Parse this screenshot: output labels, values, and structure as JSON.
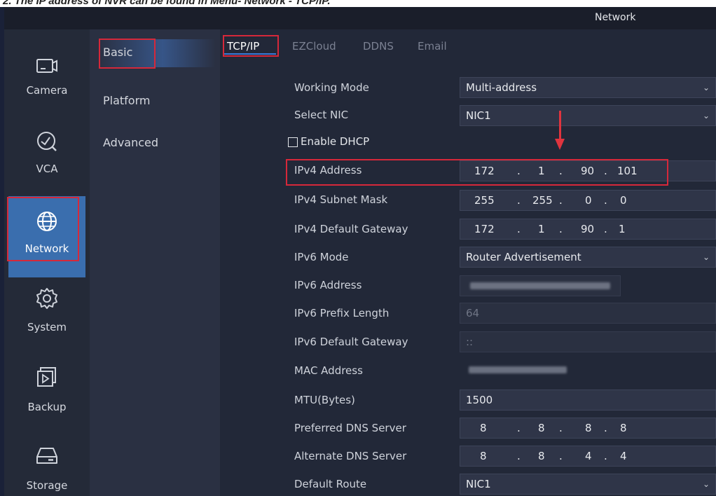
{
  "caption": "2. The IP address of NVR can be found in Menu- Network - TCP/IP.",
  "window": {
    "title": "Network"
  },
  "sidebar": {
    "items": [
      {
        "label": "Camera",
        "icon": "camera-icon"
      },
      {
        "label": "VCA",
        "icon": "vca-icon"
      },
      {
        "label": "Network",
        "icon": "globe-icon",
        "active": true
      },
      {
        "label": "System",
        "icon": "gear-icon"
      },
      {
        "label": "Backup",
        "icon": "backup-icon"
      },
      {
        "label": "Storage",
        "icon": "storage-icon"
      }
    ]
  },
  "submenu": {
    "items": [
      "Basic",
      "Platform",
      "Advanced"
    ],
    "selected": "Basic"
  },
  "tabs": [
    "TCP/IP",
    "EZCloud",
    "DDNS",
    "Email"
  ],
  "form": {
    "working_mode": {
      "label": "Working Mode",
      "value": "Multi-address"
    },
    "select_nic": {
      "label": "Select NIC",
      "value": "NIC1"
    },
    "enable_dhcp": {
      "label": "Enable DHCP",
      "checked": false
    },
    "ipv4_address": {
      "label": "IPv4 Address",
      "octets": [
        "172",
        "1",
        "90",
        "101"
      ]
    },
    "ipv4_subnet_mask": {
      "label": "IPv4 Subnet Mask",
      "octets": [
        "255",
        "255",
        "0",
        "0"
      ]
    },
    "ipv4_default_gateway": {
      "label": "IPv4 Default Gateway",
      "octets": [
        "172",
        "1",
        "90",
        "1"
      ]
    },
    "ipv6_mode": {
      "label": "IPv6 Mode",
      "value": "Router Advertisement"
    },
    "ipv6_address": {
      "label": "IPv6 Address"
    },
    "ipv6_prefix_length": {
      "label": "IPv6 Prefix Length",
      "value": "64"
    },
    "ipv6_default_gateway": {
      "label": "IPv6 Default Gateway",
      "value": "::"
    },
    "mac_address": {
      "label": "MAC Address"
    },
    "mtu": {
      "label": "MTU(Bytes)",
      "value": "1500"
    },
    "preferred_dns": {
      "label": "Preferred DNS Server",
      "octets": [
        "8",
        "8",
        "8",
        "8"
      ]
    },
    "alternate_dns": {
      "label": "Alternate DNS Server",
      "octets": [
        "8",
        "8",
        "4",
        "4"
      ]
    },
    "default_route": {
      "label": "Default Route",
      "value": "NIC1"
    }
  },
  "ip_separator": ".",
  "colors": {
    "accent": "#3a6eae",
    "highlight": "#d6283a",
    "background": "#1a2138"
  }
}
